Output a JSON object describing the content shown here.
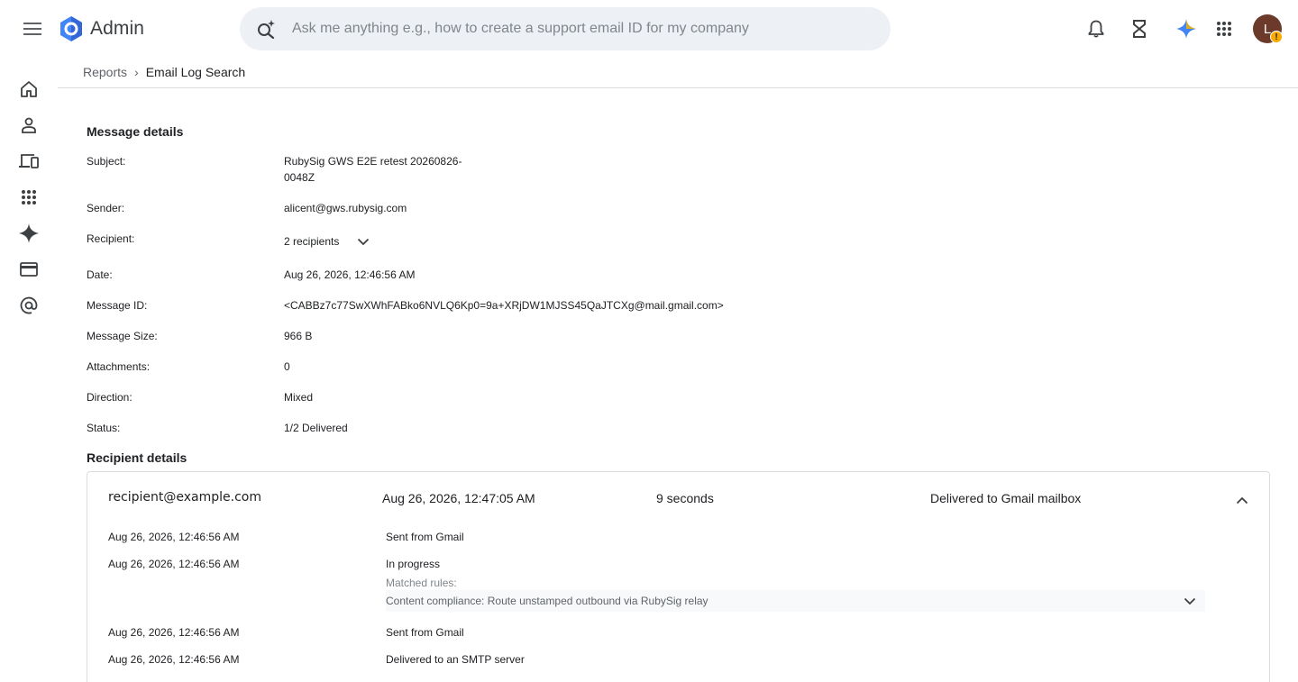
{
  "app": {
    "title": "Admin"
  },
  "search": {
    "placeholder": "Ask me anything e.g., how to create a support email ID for my company"
  },
  "avatar": {
    "initial": "L",
    "badge": "!"
  },
  "breadcrumb": {
    "parent": "Reports",
    "separator": "›",
    "current": "Email Log Search"
  },
  "message_details": {
    "title": "Message details",
    "subject_label": "Subject:",
    "subject_line1": "RubySig GWS E2E retest 20260826-",
    "subject_line2": "0048Z",
    "sender_label": "Sender:",
    "sender": "alicent@gws.rubysig.com",
    "recipient_label": "Recipient:",
    "recipient": "2 recipients",
    "date_label": "Date:",
    "date": "Aug 26, 2026, 12:46:56 AM",
    "message_id_label": "Message ID:",
    "message_id": "<CABBz7c77SwXWhFABko6NVLQ6Kp0=9a+XRjDW1MJSS45QaJTCXg@mail.gmail.com>",
    "size_label": "Message Size:",
    "size": "966 B",
    "attachments_label": "Attachments:",
    "attachments": "0",
    "direction_label": "Direction:",
    "direction": "Mixed",
    "status_label": "Status:",
    "status": "1/2 Delivered"
  },
  "recipient_details": {
    "title": "Recipient details",
    "card": {
      "email": "recipient@example.com",
      "time": "Aug 26, 2026, 12:47:05 AM",
      "duration": "9 seconds",
      "status": "Delivered to Gmail mailbox",
      "events": [
        {
          "time": "Aug 26, 2026, 12:46:56 AM",
          "text": "Sent from Gmail"
        },
        {
          "time": "Aug 26, 2026, 12:46:56 AM",
          "text": "In progress"
        },
        {
          "time": "Aug 26, 2026, 12:46:56 AM",
          "text": "Sent from Gmail"
        },
        {
          "time": "Aug 26, 2026, 12:46:56 AM",
          "text": "Delivered to an SMTP server"
        }
      ],
      "matched_rules_label": "Matched rules:",
      "matched_rule": "Content compliance: Route unstamped outbound via RubySig relay"
    }
  },
  "colors": {
    "search_bg": "#edf0f4",
    "avatar_bg": "#6b3a2a",
    "badge": "#f9ab00",
    "logo_blue": "#4285f4",
    "divider": "#dadce0"
  }
}
